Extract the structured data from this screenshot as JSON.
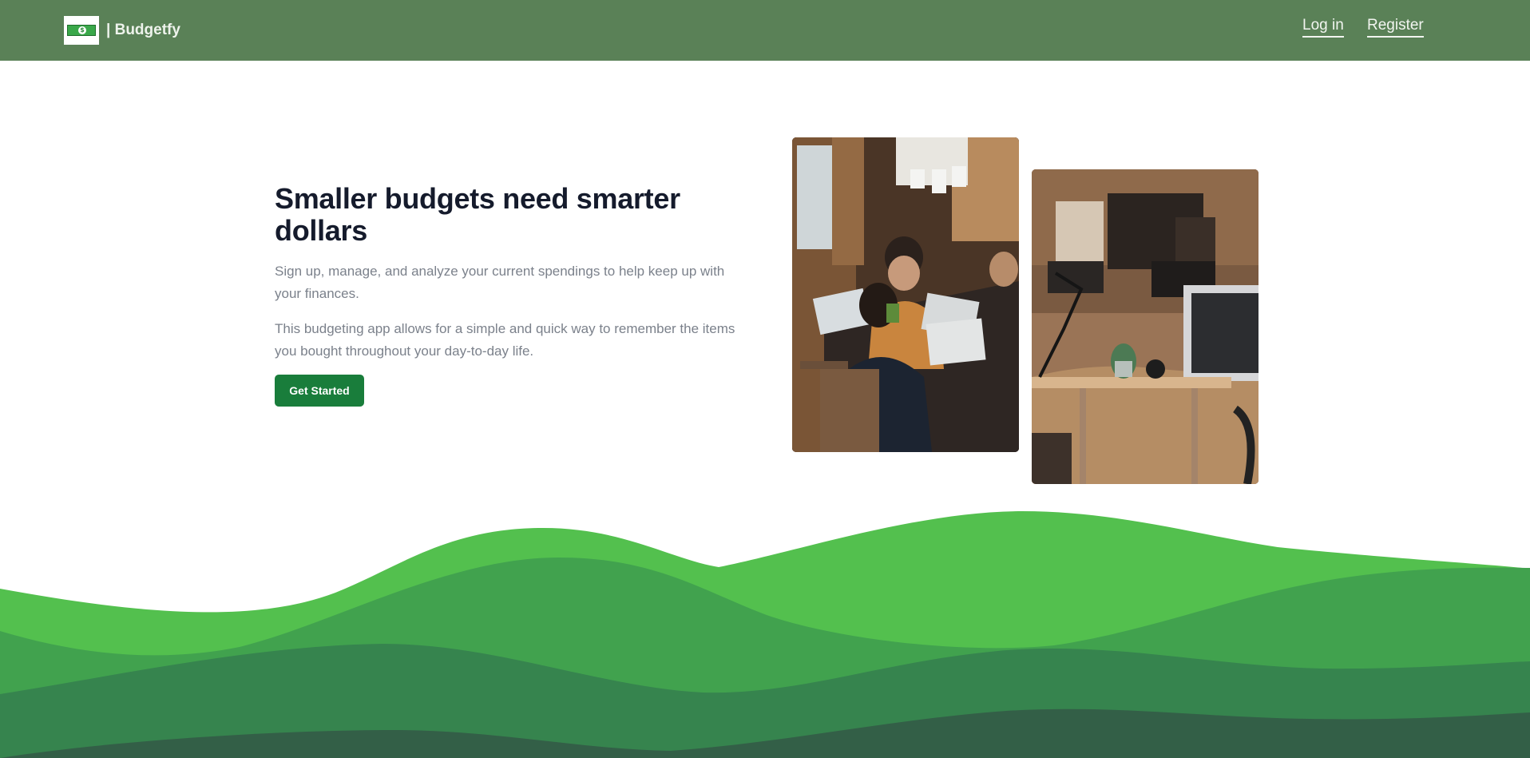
{
  "navbar": {
    "brand_text": "| Budgetfy",
    "logo_icon": "dollar-bill-icon",
    "links": [
      {
        "label": "Log in"
      },
      {
        "label": "Register"
      }
    ],
    "background": "#5a8157"
  },
  "hero": {
    "title": "Smaller budgets need smarter dollars",
    "paragraph_1": "Sign up, manage, and analyze your current spendings to help keep up with your finances.",
    "paragraph_2": "This budgeting app allows for a simple and quick way to remember the items you bought throughout your day-to-day life.",
    "cta_label": "Get Started",
    "accent_color": "#197d3b"
  },
  "images": [
    {
      "name": "team-working-at-laptops-photo"
    },
    {
      "name": "office-workspace-photo"
    }
  ],
  "waves_colors": [
    "#53c04e",
    "#41a24e",
    "#36844e",
    "#335f47"
  ]
}
